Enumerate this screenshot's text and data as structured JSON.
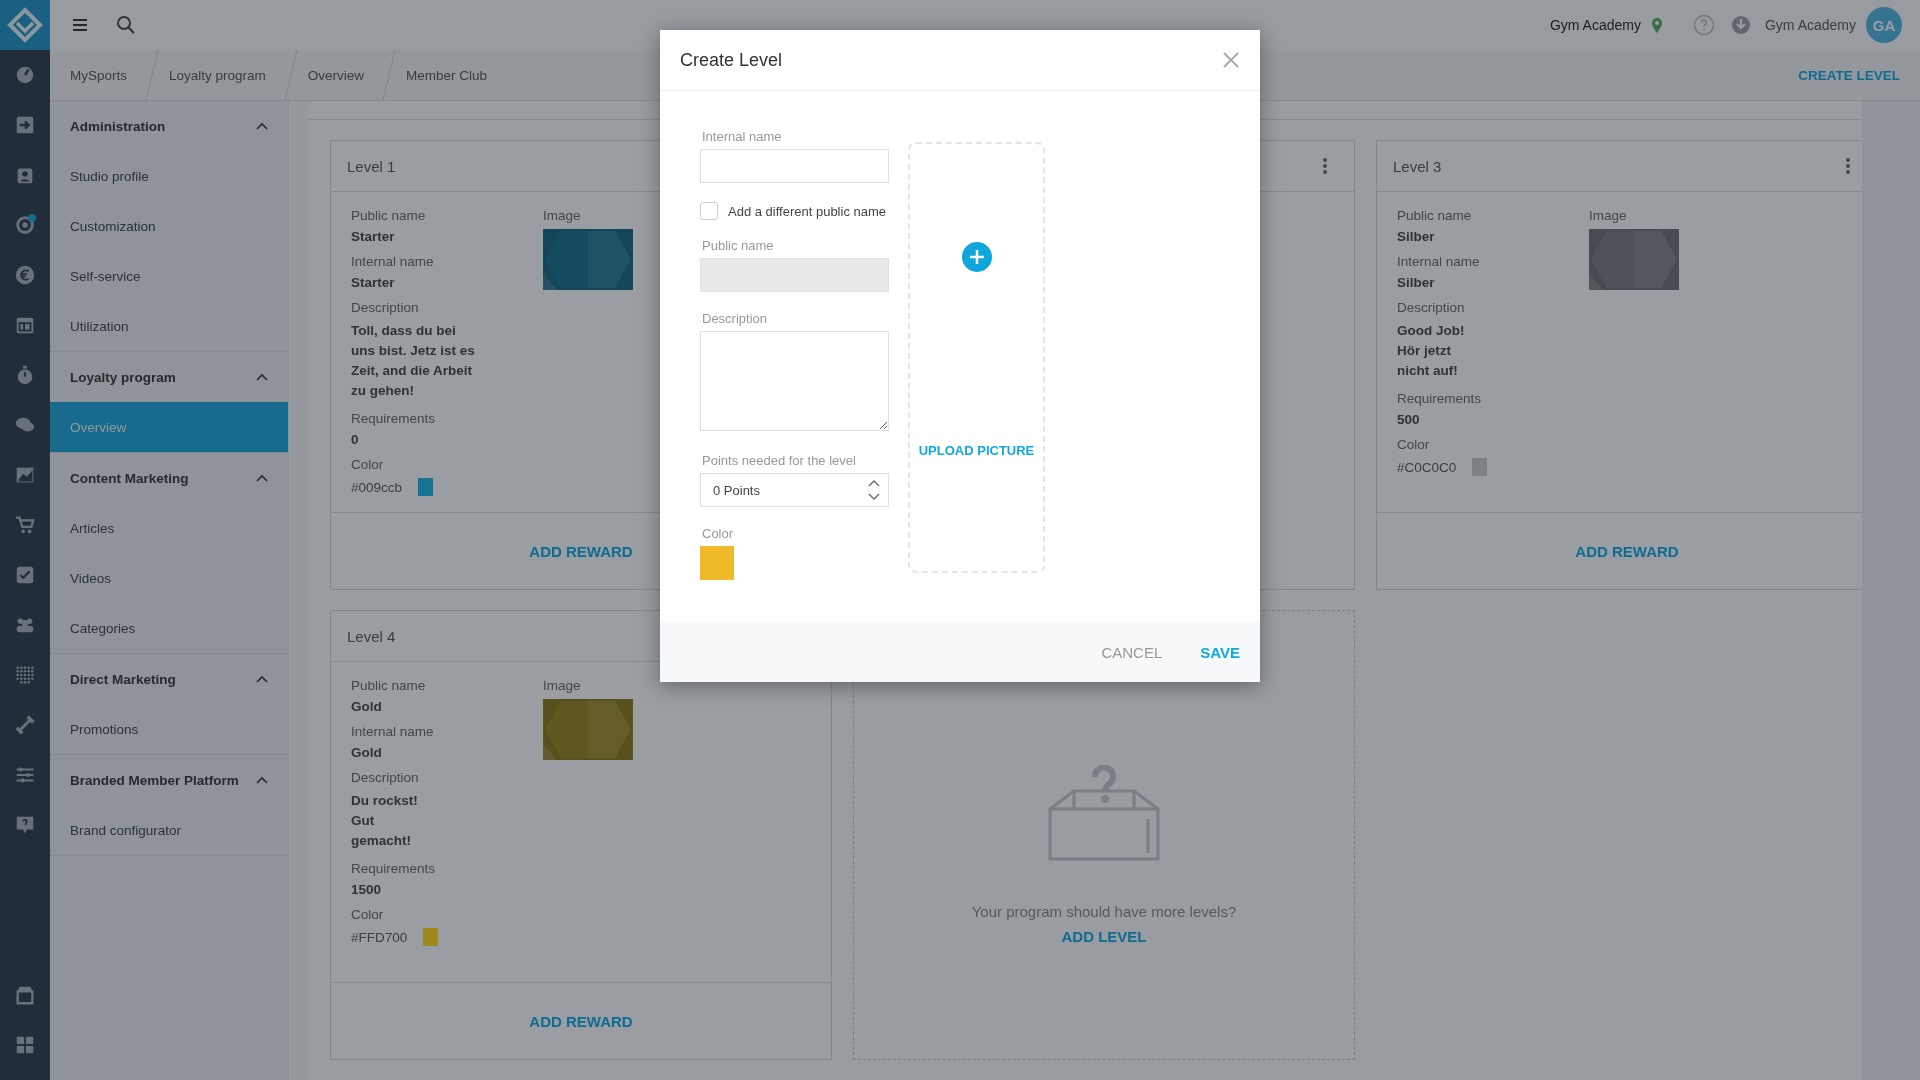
{
  "rail_icons": [
    {
      "kind": "gauge",
      "badge": false
    },
    {
      "kind": "signin",
      "badge": false
    },
    {
      "kind": "contact",
      "badge": false
    },
    {
      "kind": "target",
      "badge": true
    },
    {
      "kind": "euro",
      "badge": false
    },
    {
      "kind": "calendar",
      "badge": false
    },
    {
      "kind": "stopwatch",
      "badge": false
    },
    {
      "kind": "chat",
      "badge": false
    },
    {
      "kind": "chart",
      "badge": false
    },
    {
      "kind": "cart",
      "badge": false
    },
    {
      "kind": "check",
      "badge": false
    },
    {
      "kind": "group",
      "badge": false
    },
    {
      "kind": "dots",
      "badge": false
    },
    {
      "kind": "dumbbell",
      "badge": false
    },
    {
      "kind": "sliders",
      "badge": false
    },
    {
      "kind": "help",
      "badge": false
    }
  ],
  "rail_bottom_icons": [
    {
      "kind": "store",
      "badge": false
    },
    {
      "kind": "grid",
      "badge": false
    }
  ],
  "top_bar": {
    "location": "Gym Academy",
    "user_name": "Gym Academy",
    "initials": "GA"
  },
  "breadcrumbs": [
    "MySports",
    "Loyalty program",
    "Overview",
    "Member Club"
  ],
  "create_level": "CREATE LEVEL",
  "sidebar": [
    {
      "title": "Administration",
      "expanded": true,
      "items": [
        {
          "label": "Studio profile",
          "selected": false
        },
        {
          "label": "Customization",
          "selected": false
        },
        {
          "label": "Self-service",
          "selected": false
        },
        {
          "label": "Utilization",
          "selected": false
        }
      ]
    },
    {
      "title": "Loyalty program",
      "expanded": true,
      "items": [
        {
          "label": "Overview",
          "selected": true
        }
      ]
    },
    {
      "title": "Content Marketing",
      "expanded": true,
      "items": [
        {
          "label": "Articles",
          "selected": false
        },
        {
          "label": "Videos",
          "selected": false
        },
        {
          "label": "Categories",
          "selected": false
        }
      ]
    },
    {
      "title": "Direct Marketing",
      "expanded": true,
      "items": [
        {
          "label": "Promotions",
          "selected": false
        }
      ]
    },
    {
      "title": "Branded Member Platform",
      "expanded": true,
      "items": [
        {
          "label": "Brand configurator",
          "selected": false
        }
      ]
    }
  ],
  "levels": [
    {
      "kind": "level",
      "title": "Level 1",
      "menu": false,
      "public_label": "Public name",
      "public_name": "Starter",
      "internal_label": "Internal name",
      "internal_name": "Starter",
      "description_label": "Description",
      "description": "Toll, dass du bei\nuns bist. Jetz ist es\nZeit, and die Arbeit\nzu gehen!",
      "requirements_label": "Requirements",
      "requirements": "0",
      "color_label": "Color",
      "color_value": "#009ccb",
      "color": "#177391",
      "image_label": "Image",
      "action": "ADD REWARD"
    },
    {
      "kind": "covered",
      "menu": true
    },
    {
      "kind": "level",
      "title": "Level 3",
      "menu": true,
      "public_label": "Public name",
      "public_name": "Silber",
      "internal_label": "Internal name",
      "internal_name": "Silber",
      "description_label": "Description",
      "description": "Good Job!\nHör jetzt\nnicht auf!",
      "requirements_label": "Requirements",
      "requirements": "500",
      "color_label": "Color",
      "color_value": "#C0C0C0",
      "color": "#7d8185",
      "image_label": "Image",
      "action": "ADD REWARD"
    },
    {
      "kind": "level",
      "title": "Level 4",
      "menu": false,
      "public_label": "Public name",
      "public_name": "Gold",
      "internal_label": "Internal name",
      "internal_name": "Gold",
      "description_label": "Description",
      "description": "Du rockst!\nGut\ngemacht!",
      "requirements_label": "Requirements",
      "requirements": "1500",
      "color_label": "Color",
      "color_value": "#FFD700",
      "color": "#9c8a1e",
      "image_label": "Image",
      "action": "ADD REWARD"
    },
    {
      "kind": "empty",
      "message": "Your program should have more levels?",
      "action": "ADD LEVEL"
    }
  ],
  "modal": {
    "title": "Create Level",
    "fields": [
      {
        "kind": "text",
        "label": "Internal name"
      },
      {
        "kind": "checkbox",
        "label": "Add a different public name",
        "checked": false
      },
      {
        "kind": "text",
        "label": "Public name",
        "disabled": true
      },
      {
        "kind": "textarea",
        "label": "Description"
      },
      {
        "kind": "number",
        "label": "Points needed for the level",
        "value": "0 Points"
      },
      {
        "kind": "color",
        "label": "Color",
        "color": "#f0b92a"
      }
    ],
    "upload": "UPLOAD PICTURE",
    "buttons": [
      {
        "label": "CANCEL",
        "primary": false
      },
      {
        "label": "SAVE",
        "primary": true
      }
    ]
  }
}
